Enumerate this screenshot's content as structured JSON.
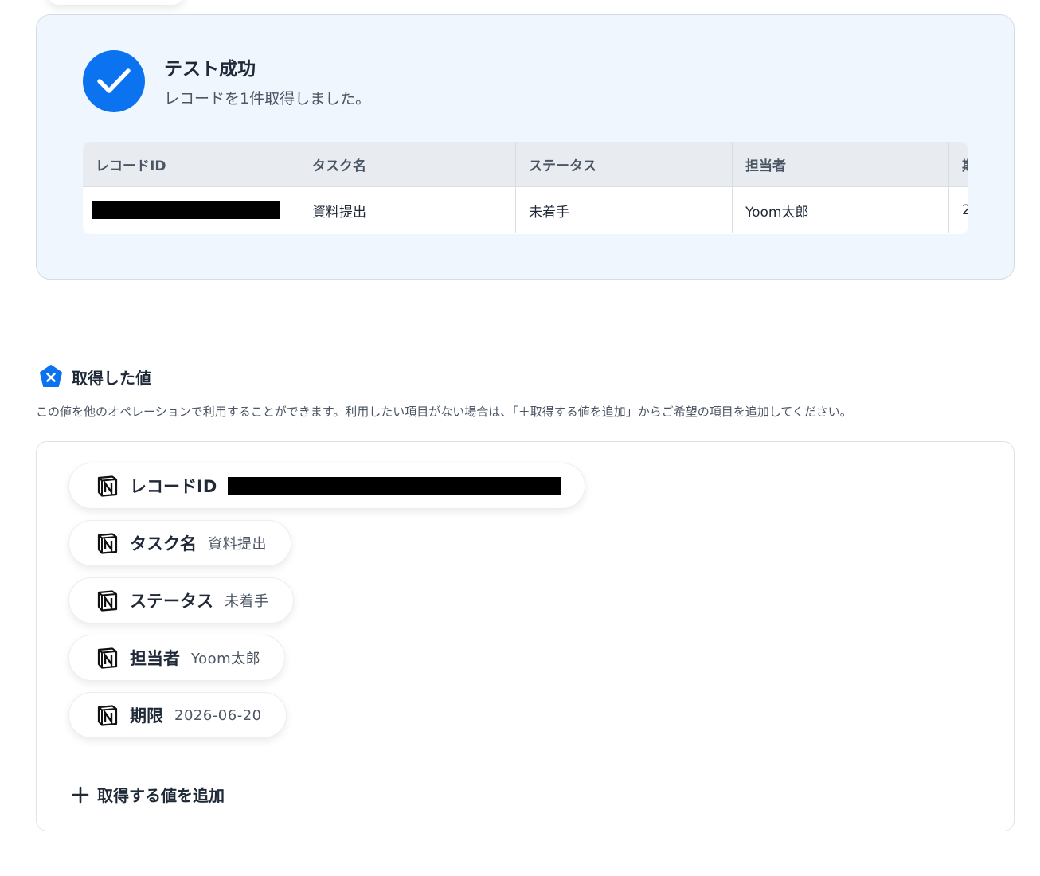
{
  "success": {
    "title": "テスト成功",
    "subtitle": "レコードを1件取得しました。"
  },
  "table": {
    "headers": [
      "レコードID",
      "タスク名",
      "ステータス",
      "担当者",
      "期"
    ],
    "row": [
      "",
      "資料提出",
      "未着手",
      "Yoom太郎",
      "2"
    ]
  },
  "section": {
    "title": "取得した値",
    "description": "この値を他のオペレーションで利用することができます。利用したい項目がない場合は、「＋取得する値を追加」からご希望の項目を追加してください。"
  },
  "values": [
    {
      "label": "レコードID",
      "value": ""
    },
    {
      "label": "タスク名",
      "value": "資料提出"
    },
    {
      "label": "ステータス",
      "value": "未着手"
    },
    {
      "label": "担当者",
      "value": "Yoom太郎"
    },
    {
      "label": "期限",
      "value": "2026-06-20"
    }
  ],
  "add_button": {
    "label": "取得する値を追加"
  },
  "icons": {
    "check": "check-icon",
    "section": "yoom-badge-icon",
    "value": "notion-icon",
    "add": "plus-icon"
  },
  "colors": {
    "accent": "#0b73f0",
    "panel_bg": "#f0f6fe"
  }
}
